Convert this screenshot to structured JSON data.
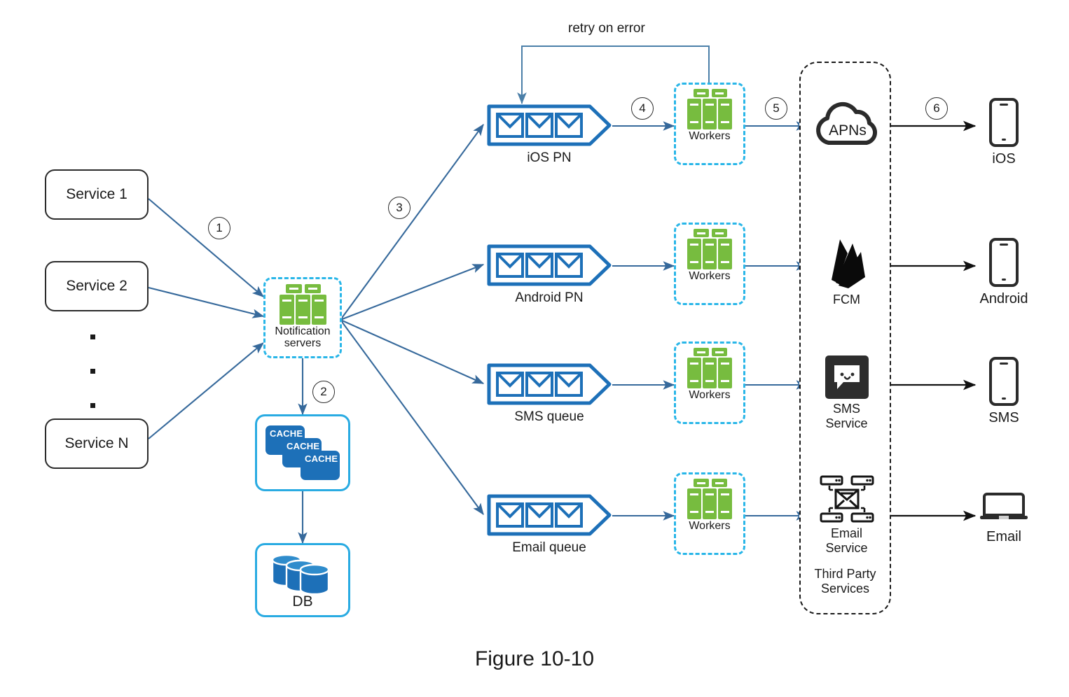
{
  "figure": {
    "caption": "Figure 10-10"
  },
  "annotations": {
    "retry_on_error": "retry on error"
  },
  "colors": {
    "queue_blue": "#1d70b8",
    "arrow_blue": "#36699b",
    "server_green": "#77bc3f",
    "dashed_cyan": "#29b6e8",
    "card_blue": "#29abe2",
    "ink": "#1a1a1a"
  },
  "services": {
    "items": [
      {
        "label": "Service 1"
      },
      {
        "label": "Service 2"
      },
      {
        "label": "Service N"
      }
    ],
    "ellipsis": "vertical-dots"
  },
  "notification_servers": {
    "label_line1": "Notification",
    "label_line2": "servers",
    "icon": "server-stack-icon"
  },
  "storage": {
    "cache": {
      "chips": [
        "CACHE",
        "CACHE",
        "CACHE"
      ],
      "icon": "cache-stack-icon"
    },
    "db": {
      "label": "DB",
      "icon": "database-cylinders-icon"
    }
  },
  "queues": [
    {
      "label": "iOS PN",
      "icon": "message-queue-icon"
    },
    {
      "label": "Android PN",
      "icon": "message-queue-icon"
    },
    {
      "label": "SMS queue",
      "icon": "message-queue-icon"
    },
    {
      "label": "Email queue",
      "icon": "message-queue-icon"
    }
  ],
  "workers": [
    {
      "label": "Workers",
      "icon": "server-stack-icon"
    },
    {
      "label": "Workers",
      "icon": "server-stack-icon"
    },
    {
      "label": "Workers",
      "icon": "server-stack-icon"
    },
    {
      "label": "Workers",
      "icon": "server-stack-icon"
    }
  ],
  "third_party": {
    "footer_line1": "Third Party",
    "footer_line2": "Services",
    "items": [
      {
        "name": "APNs",
        "caption": "",
        "icon": "apns-cloud-icon",
        "inline_label": "APNs"
      },
      {
        "name": "FCM",
        "caption": "FCM",
        "icon": "firebase-flame-icon",
        "inline_label": ""
      },
      {
        "name": "SMS Service",
        "caption_line1": "SMS",
        "caption_line2": "Service",
        "icon": "sms-chat-bubble-icon",
        "inline_label": ""
      },
      {
        "name": "Email Service",
        "caption_line1": "Email",
        "caption_line2": "Service",
        "icon": "email-network-icon",
        "inline_label": ""
      }
    ]
  },
  "devices": [
    {
      "label": "iOS",
      "icon": "smartphone-icon"
    },
    {
      "label": "Android",
      "icon": "smartphone-icon"
    },
    {
      "label": "SMS",
      "icon": "smartphone-icon"
    },
    {
      "label": "Email",
      "icon": "laptop-icon"
    }
  ],
  "steps": [
    {
      "number": "1"
    },
    {
      "number": "2"
    },
    {
      "number": "3"
    },
    {
      "number": "4"
    },
    {
      "number": "5"
    },
    {
      "number": "6"
    }
  ]
}
